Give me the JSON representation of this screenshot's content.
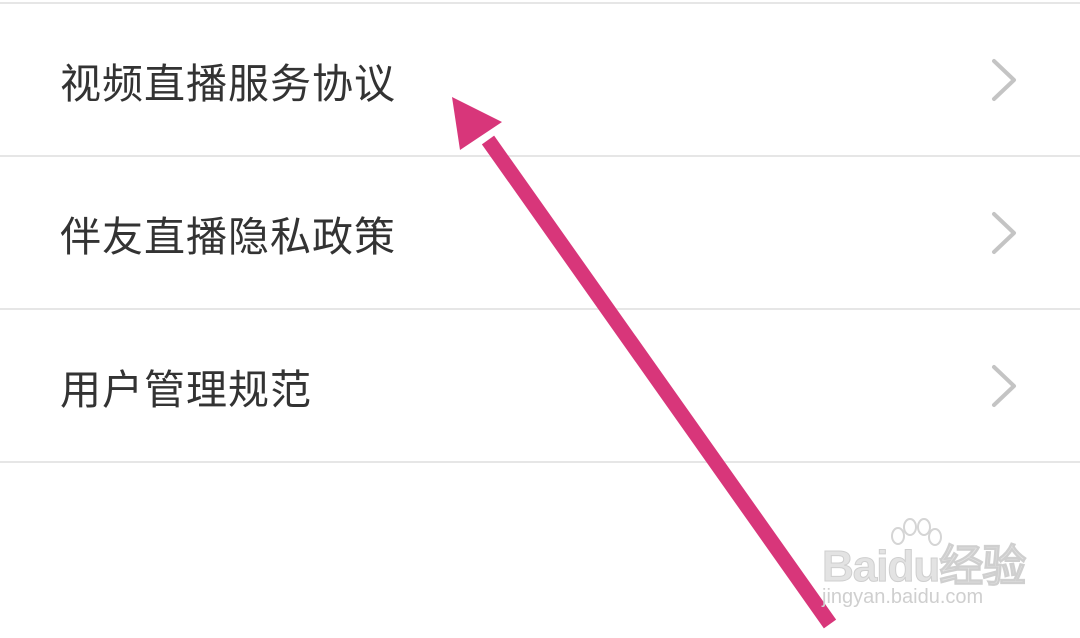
{
  "menu": {
    "items": [
      {
        "label": "视频直播服务协议"
      },
      {
        "label": "伴友直播隐私政策"
      },
      {
        "label": "用户管理规范"
      }
    ]
  },
  "icons": {
    "chevron": "chevron-right-icon",
    "annotation_arrow": "arrow-icon"
  },
  "colors": {
    "arrow": "#d8367a",
    "label": "#333333",
    "divider": "#e6e6e6",
    "chevron": "#c4c4c4"
  },
  "watermark": {
    "logo": "Baidu经验",
    "url": "jingyan.baidu.com"
  }
}
